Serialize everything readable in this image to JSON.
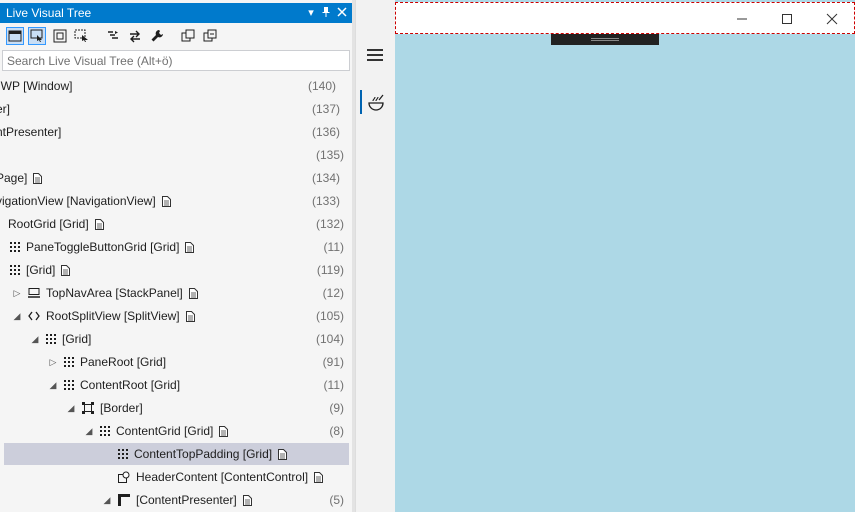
{
  "panel": {
    "title": "Live Visual Tree",
    "search_placeholder": "Search Live Visual Tree (Alt+ö)"
  },
  "tree": [
    {
      "label": "UWP [Window]",
      "count": "(140)",
      "indent": -8,
      "expander": "",
      "icon": "",
      "doc": false
    },
    {
      "label": "er]",
      "count": "(137)",
      "indent": -4,
      "expander": "",
      "icon": "",
      "doc": false
    },
    {
      "label": "ntPresenter]",
      "count": "(136)",
      "indent": -4,
      "expander": "",
      "icon": "",
      "doc": false
    },
    {
      "label": "",
      "count": "(135)",
      "indent": 0,
      "expander": "",
      "icon": "",
      "doc": false
    },
    {
      "label": "Page]",
      "count": "(134)",
      "indent": -4,
      "expander": "",
      "icon": "",
      "doc": true
    },
    {
      "label": "vigationView [NavigationView]",
      "count": "(133)",
      "indent": -4,
      "expander": "",
      "icon": "",
      "doc": true
    },
    {
      "label": "RootGrid [Grid]",
      "count": "(132)",
      "indent": 8,
      "expander": "",
      "icon": "",
      "doc": true
    },
    {
      "label": "PaneToggleButtonGrid [Grid]",
      "count": "(11)",
      "indent": 10,
      "expander": "",
      "icon": "grid",
      "doc": true
    },
    {
      "label": "[Grid]",
      "count": "(119)",
      "indent": 10,
      "expander": "",
      "icon": "grid",
      "doc": true
    },
    {
      "label": "TopNavArea [StackPanel]",
      "count": "(12)",
      "indent": 12,
      "expander": "▷",
      "icon": "stack",
      "doc": true
    },
    {
      "label": "RootSplitView [SplitView]",
      "count": "(105)",
      "indent": 12,
      "expander": "◢",
      "icon": "split",
      "doc": true
    },
    {
      "label": "[Grid]",
      "count": "(104)",
      "indent": 30,
      "expander": "◢",
      "icon": "grid",
      "doc": false
    },
    {
      "label": "PaneRoot [Grid]",
      "count": "(91)",
      "indent": 48,
      "expander": "▷",
      "icon": "grid",
      "doc": false
    },
    {
      "label": "ContentRoot [Grid]",
      "count": "(11)",
      "indent": 48,
      "expander": "◢",
      "icon": "grid",
      "doc": false
    },
    {
      "label": "[Border]",
      "count": "(9)",
      "indent": 66,
      "expander": "◢",
      "icon": "border",
      "doc": false
    },
    {
      "label": "ContentGrid [Grid]",
      "count": "(8)",
      "indent": 84,
      "expander": "◢",
      "icon": "grid",
      "doc": true
    },
    {
      "label": "ContentTopPadding [Grid]",
      "count": "",
      "indent": 102,
      "expander": " ",
      "icon": "grid",
      "doc": true,
      "selected": true
    },
    {
      "label": "HeaderContent [ContentControl]",
      "count": "",
      "indent": 102,
      "expander": " ",
      "icon": "content",
      "doc": true
    },
    {
      "label": "[ContentPresenter]",
      "count": "(5)",
      "indent": 102,
      "expander": "◢",
      "icon": "presenter",
      "doc": true
    }
  ],
  "colors": {
    "title_bar": "#007acc",
    "app_background": "#add8e6",
    "selected_row": "#cccedb",
    "nav_accent": "#0063b1"
  }
}
